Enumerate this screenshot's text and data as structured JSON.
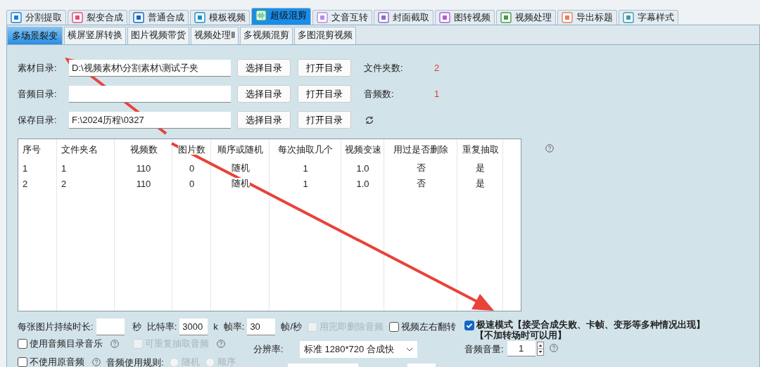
{
  "main_tabs": [
    {
      "label": "分割提取",
      "selected": false
    },
    {
      "label": "裂变合成",
      "selected": false
    },
    {
      "label": "普通合成",
      "selected": false
    },
    {
      "label": "模板视频",
      "selected": false
    },
    {
      "label": "超级混剪",
      "selected": true
    },
    {
      "label": "文音互转",
      "selected": false
    },
    {
      "label": "封面截取",
      "selected": false
    },
    {
      "label": "图转视频",
      "selected": false
    },
    {
      "label": "视频处理",
      "selected": false
    },
    {
      "label": "导出标题",
      "selected": false
    },
    {
      "label": "字幕样式",
      "selected": false
    }
  ],
  "sub_tabs": [
    {
      "label": "多场景裂变",
      "selected": true
    },
    {
      "label": "横屏竖屏转换",
      "selected": false
    },
    {
      "label": "图片视频带货",
      "selected": false
    },
    {
      "label": "视频处理Ⅱ",
      "selected": false
    },
    {
      "label": "多视频混剪",
      "selected": false
    },
    {
      "label": "多图混剪视频",
      "selected": false
    }
  ],
  "directories": [
    {
      "kind": "count",
      "label": "素材目录:",
      "value": "D:\\视频素材\\分割素材\\测试子夹",
      "select_button": "选择目录",
      "open_button": "打开目录",
      "count_label": "文件夹数:",
      "count": "2"
    },
    {
      "kind": "count",
      "label": "音频目录:",
      "select_button": "选择目录",
      "open_button": "打开目录",
      "count_label": "音频数:",
      "count": "1"
    },
    {
      "kind": "refresh",
      "label": "保存目录:",
      "value": "F:\\2024历程\\0327",
      "select_button": "选择目录",
      "open_button": "打开目录"
    }
  ],
  "table": {
    "columns": [
      "序号",
      "文件夹名",
      "视频数",
      "图片数",
      "顺序或随机",
      "每次抽取几个",
      "视频变速",
      "用过是否删除",
      "重复抽取"
    ],
    "rows": [
      [
        "1",
        "1",
        "110",
        "0",
        "随机",
        "1",
        "1.0",
        "否",
        "是"
      ],
      [
        "2",
        "2",
        "110",
        "0",
        "随机",
        "1",
        "1.0",
        "否",
        "是"
      ]
    ]
  },
  "settings": {
    "duration_label": "每张图片持续时长:",
    "duration_unit": "秒",
    "bitrate_label": "比特率:",
    "bitrate": "3000",
    "bitrate_unit": "k",
    "fps_label": "帧率:",
    "fps": "30",
    "fps_unit": "帧/秒",
    "delete_audio": {
      "label": "用完即删除音频",
      "checked": false,
      "disabled": true
    },
    "flip": {
      "label": "视频左右翻转",
      "checked": false,
      "disabled": false
    },
    "fast_mode": {
      "label": "极速模式【接受合成失败、卡帧、变形等多种情况出现】",
      "note": "【不加转场时可以用】",
      "checked": true,
      "disabled": false
    },
    "use_audio_dir": {
      "label": "使用音频目录音乐",
      "checked": false,
      "disabled": false
    },
    "repeat_audio": {
      "label": "可重复抽取音频",
      "checked": false,
      "disabled": true
    },
    "resolution_label": "分辨率:",
    "resolution": "标准 1280*720 合成快",
    "volume_label": "音频音量:",
    "volume": "1",
    "no_original_audio": {
      "label": "不使用原音频",
      "checked": false,
      "disabled": false
    },
    "audio_rule_label": "音频使用规则:",
    "audio_rule": [
      {
        "label": "随机",
        "selected": false,
        "disabled": true
      },
      {
        "label": "顺序",
        "selected": false,
        "disabled": true
      }
    ]
  }
}
